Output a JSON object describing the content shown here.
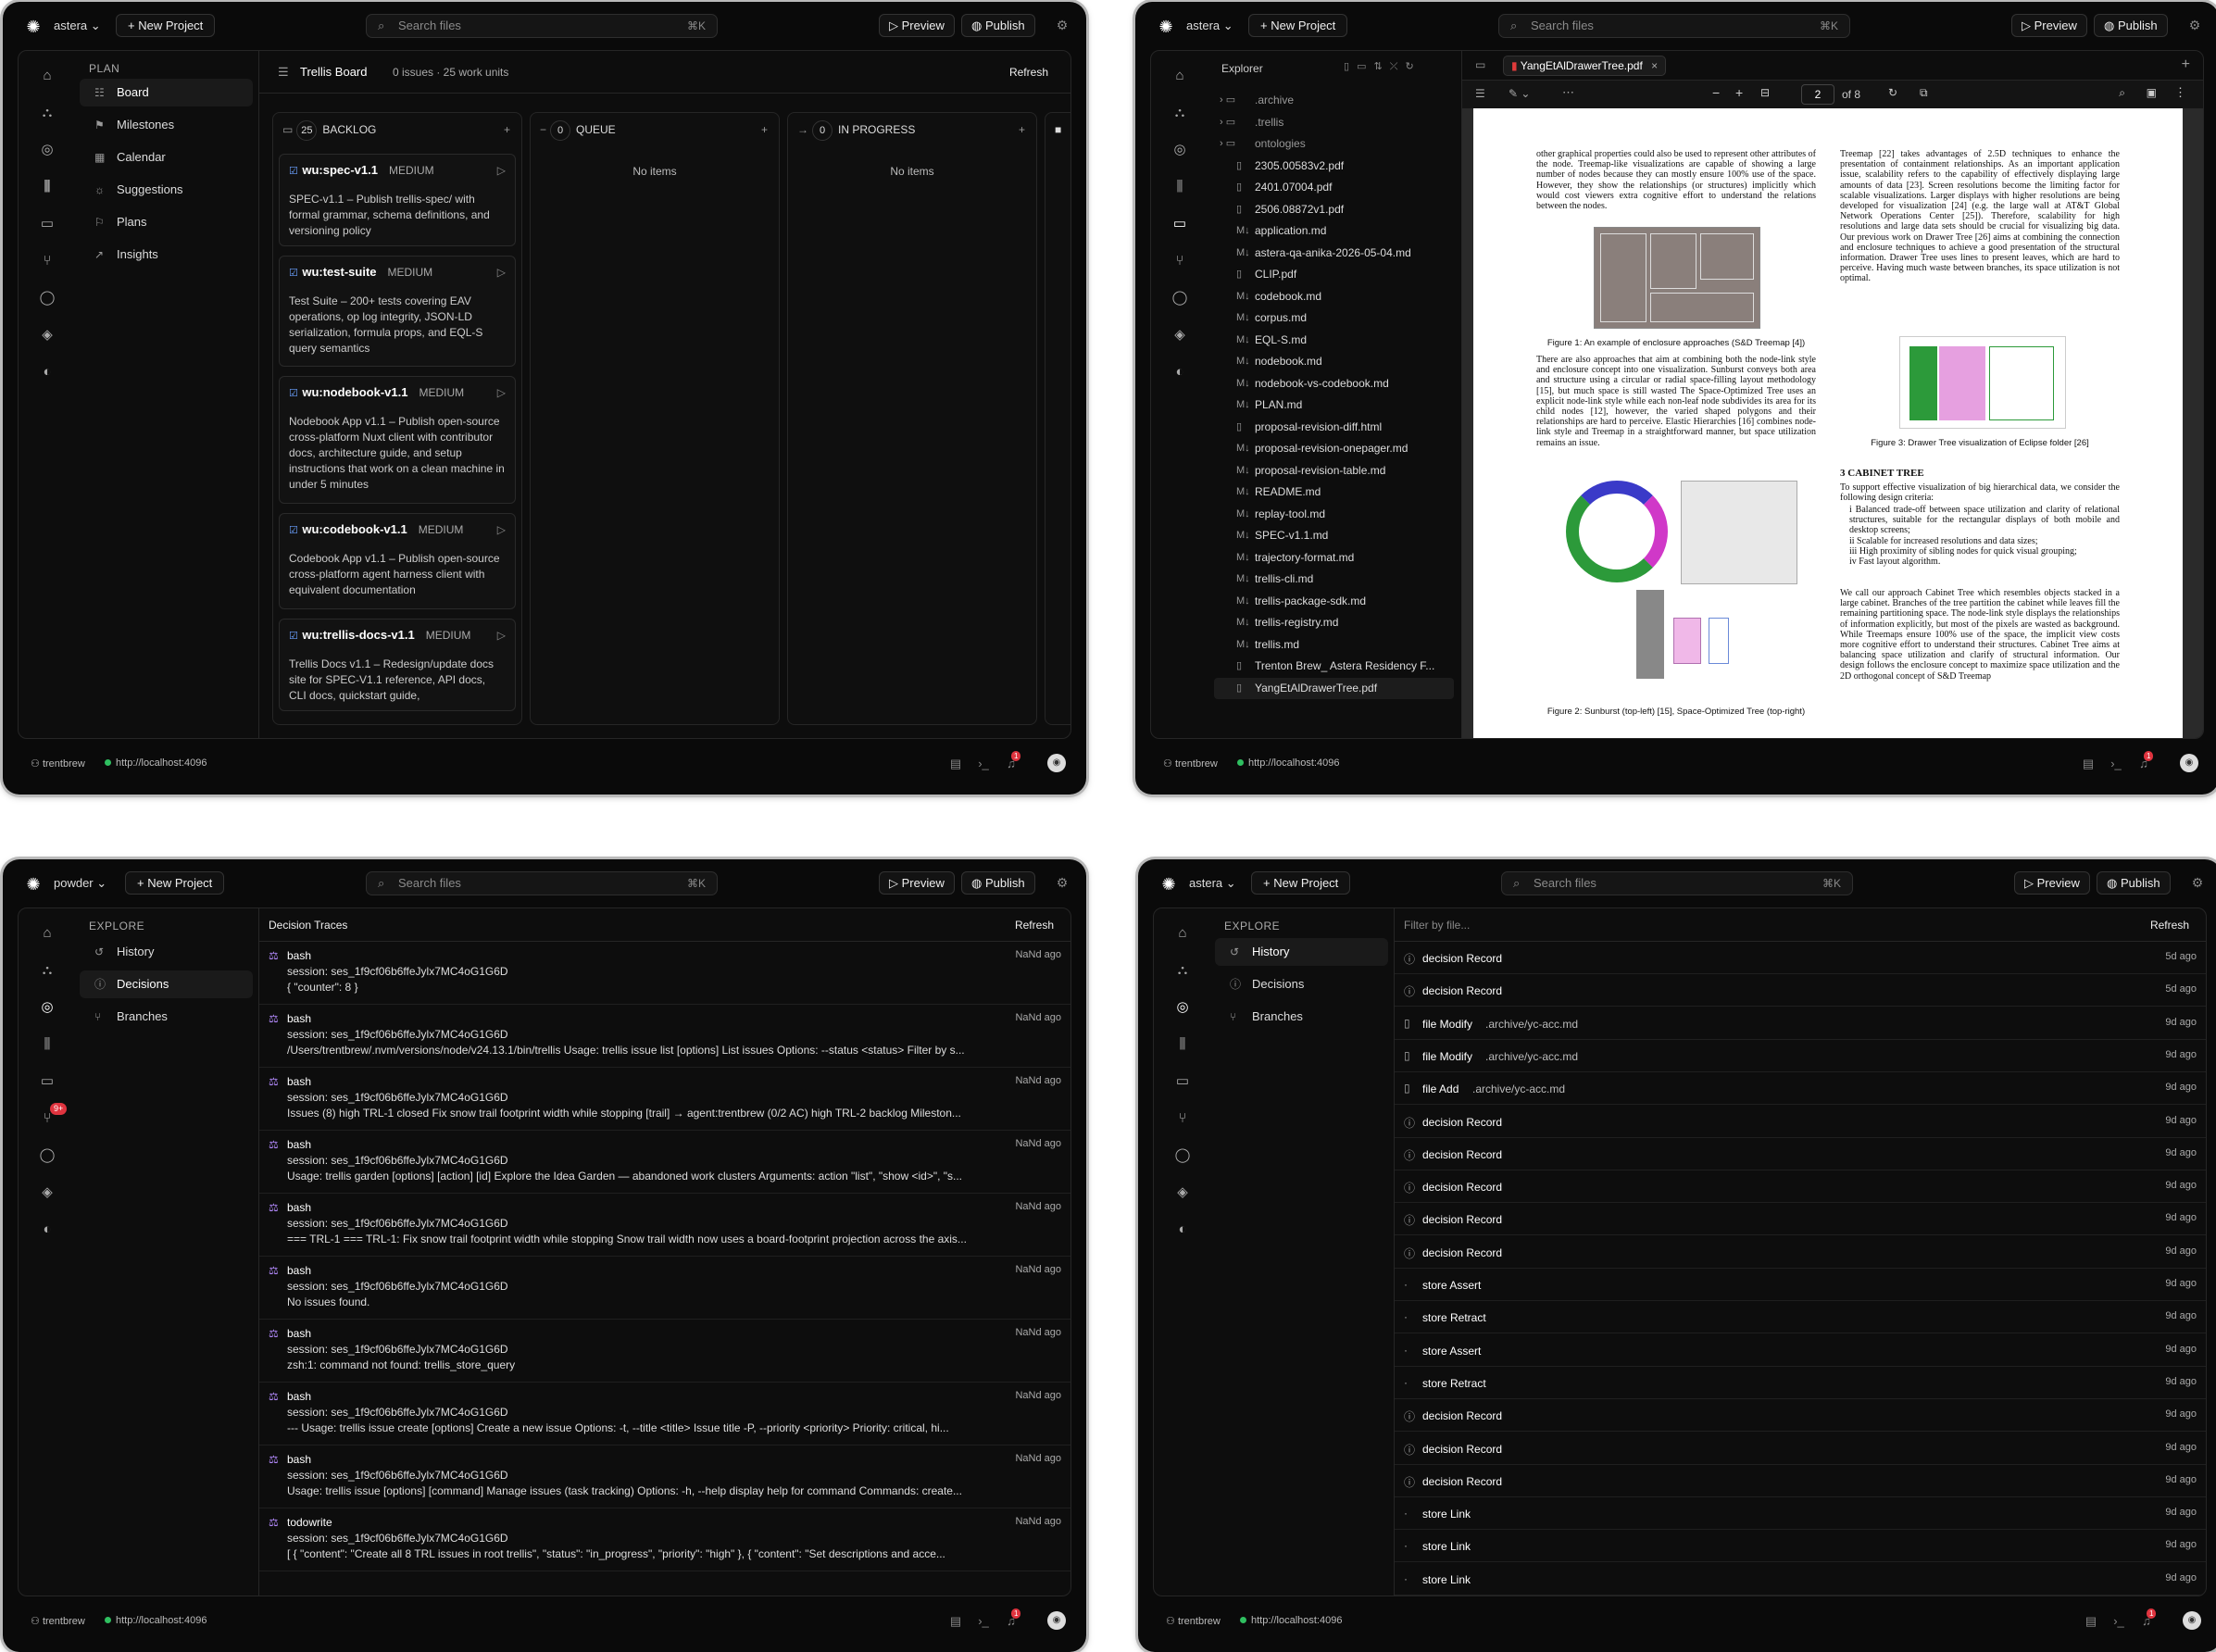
{
  "common": {
    "search_placeholder": "Search files",
    "search_kbd": "⌘K",
    "new_project": "New Project",
    "preview": "Preview",
    "publish": "Publish",
    "user": "trentbrew",
    "host": "http://localhost:4096",
    "notif_count": "1"
  },
  "w1": {
    "project": "astera",
    "sidebar_heading": "PLAN",
    "sidebar_items": [
      "Board",
      "Milestones",
      "Calendar",
      "Suggestions",
      "Plans",
      "Insights"
    ],
    "board_title": "Trellis Board",
    "board_meta": "0 issues · 25 work units",
    "refresh": "Refresh",
    "columns": [
      {
        "name": "BACKLOG",
        "count": "25"
      },
      {
        "name": "QUEUE",
        "count": "0",
        "empty": "No items"
      },
      {
        "name": "IN PROGRESS",
        "count": "0",
        "empty": "No items"
      }
    ],
    "cards": [
      {
        "title": "wu:spec-v1.1",
        "priority": "MEDIUM",
        "desc": "SPEC-v1.1 – Publish trellis-spec/ with formal grammar, schema definitions, and versioning policy"
      },
      {
        "title": "wu:test-suite",
        "priority": "MEDIUM",
        "desc": "Test Suite – 200+ tests covering EAV operations, op log integrity, JSON-LD serialization, formula props, and EQL-S query semantics"
      },
      {
        "title": "wu:nodebook-v1.1",
        "priority": "MEDIUM",
        "desc": "Nodebook App v1.1 – Publish open-source cross-platform Nuxt client with contributor docs, architecture guide, and setup instructions that work on a clean machine in under 5 minutes"
      },
      {
        "title": "wu:codebook-v1.1",
        "priority": "MEDIUM",
        "desc": "Codebook App v1.1 – Publish open-source cross-platform agent harness client with equivalent documentation"
      },
      {
        "title": "wu:trellis-docs-v1.1",
        "priority": "MEDIUM",
        "desc": "Trellis Docs v1.1 – Redesign/update docs site for SPEC-V1.1 reference, API docs, CLI docs, quickstart guide,"
      }
    ]
  },
  "w2": {
    "project": "astera",
    "explorer_title": "Explorer",
    "tab_name": "YangEtAlDrawerTree.pdf",
    "page_num": "2",
    "page_total": "of 8",
    "files": [
      ".archive",
      ".trellis",
      "ontologies",
      "2305.00583v2.pdf",
      "2401.07004.pdf",
      "2506.08872v1.pdf",
      "application.md",
      "astera-qa-anika-2026-05-04.md",
      "CLIP.pdf",
      "codebook.md",
      "corpus.md",
      "EQL-S.md",
      "nodebook.md",
      "nodebook-vs-codebook.md",
      "PLAN.md",
      "proposal-revision-diff.html",
      "proposal-revision-onepager.md",
      "proposal-revision-table.md",
      "README.md",
      "replay-tool.md",
      "SPEC-v1.1.md",
      "trajectory-format.md",
      "trellis-cli.md",
      "trellis-package-sdk.md",
      "trellis-registry.md",
      "trellis.md",
      "Trenton Brew_ Astera Residency F...",
      "YangEtAlDrawerTree.pdf"
    ],
    "pdf": {
      "left_col_1": "other graphical properties could also be used to represent other attributes of the node. Treemap-like visualizations are capable of showing a large number of nodes because they can mostly ensure 100% use of the space. However, they show the relationships (or structures) implicitly which would cost viewers extra cognitive effort to understand the relations between the nodes.",
      "fig1_caption": "Figure 1: An example of enclosure approaches (S&D Treemap [4])",
      "left_col_2": "There are also approaches that aim at combining both the node-link style and enclosure concept into one visualization. Sunburst conveys both area and structure using a circular or radial space-filling layout methodology [15], but much space is still wasted The Space-Optimized Tree uses an explicit node-link style while each non-leaf node subdivides its area for its child nodes [12], however, the varied shaped polygons and their relationships are hard to perceive. Elastic Hierarchies [16] combines node-link style and Treemap in a straightforward manner, but space utilization remains an issue.",
      "fig2_caption": "Figure 2: Sunburst (top-left) [15], Space-Optimized Tree (top-right)",
      "right_col_1": "Treemap [22] takes advantages of 2.5D techniques to enhance the presentation of containment relationships. As an important application issue, scalability refers to the capability of effectively displaying large amounts of data [23]. Screen resolutions become the limiting factor for scalable visualizations. Larger displays with higher resolutions are being developed for visualization [24] (e.g. the large wall at AT&T Global Network Operations Center [25]). Therefore, scalability for high resolutions and large data sets should be crucial for visualizing big data. Our previous work on Drawer Tree [26] aims at combining the connection and enclosure techniques to achieve a good presentation of the structural information. Drawer Tree uses lines to present leaves, which are hard to perceive. Having much waste between branches, its space utilization is not optimal.",
      "fig3_caption": "Figure 3: Drawer Tree visualization of Eclipse folder [26]",
      "section": "3 CABINET TREE",
      "right_col_2": "To support effective visualization of big hierarchical data, we consider the following design criteria:",
      "criteria": [
        "i Balanced trade-off between space utilization and clarity of relational structures, suitable for the rectangular displays of both mobile and desktop screens;",
        "ii Scalable for increased resolutions and data sizes;",
        "iii High proximity of sibling nodes for quick visual grouping;",
        "iv Fast layout algorithm."
      ],
      "right_col_3": "We call our approach Cabinet Tree which resembles objects stacked in a large cabinet. Branches of the tree partition the cabinet while leaves fill the remaining partitioning space. The node-link style displays the relationships of information explicitly, but most of the pixels are wasted as background. While Treemaps ensure 100% use of the space, the implicit view costs more cognitive effort to understand their structures. Cabinet Tree aims at balancing space utilization and clarify of structural information. Our design follows the enclosure concept to maximize space utilization and the 2D orthogonal concept of S&D Treemap"
    }
  },
  "w3": {
    "project": "powder",
    "rail_badge": "9+",
    "sidebar_heading": "EXPLORE",
    "sidebar_items": [
      "History",
      "Decisions",
      "Branches"
    ],
    "title": "Decision Traces",
    "refresh": "Refresh",
    "traces": [
      {
        "tool": "bash",
        "session": "session: ses_1f9cf06b6ffeJylx7MC4oG1G6D",
        "detail": "{ \"counter\": 8 }",
        "ago": "NaNd ago"
      },
      {
        "tool": "bash",
        "session": "session: ses_1f9cf06b6ffeJylx7MC4oG1G6D",
        "detail": "/Users/trentbrew/.nvm/versions/node/v24.13.1/bin/trellis Usage: trellis issue list [options] List issues Options: --status <status> Filter by s...",
        "ago": "NaNd ago"
      },
      {
        "tool": "bash",
        "session": "session: ses_1f9cf06b6ffeJylx7MC4oG1G6D",
        "detail": "Issues (8) high TRL-1 closed Fix snow trail footprint width while stopping [trail] → agent:trentbrew (0/2 AC) high TRL-2 backlog Mileston...",
        "ago": "NaNd ago"
      },
      {
        "tool": "bash",
        "session": "session: ses_1f9cf06b6ffeJylx7MC4oG1G6D",
        "detail": "Usage: trellis garden [options] [action] [id] Explore the Idea Garden — abandoned work clusters Arguments: action \"list\", \"show <id>\", \"s...",
        "ago": "NaNd ago"
      },
      {
        "tool": "bash",
        "session": "session: ses_1f9cf06b6ffeJylx7MC4oG1G6D",
        "detail": "=== TRL-1 === TRL-1: Fix snow trail footprint width while stopping Snow trail width now uses a board-footprint projection across the axis...",
        "ago": "NaNd ago"
      },
      {
        "tool": "bash",
        "session": "session: ses_1f9cf06b6ffeJylx7MC4oG1G6D",
        "detail": "No issues found.",
        "ago": "NaNd ago"
      },
      {
        "tool": "bash",
        "session": "session: ses_1f9cf06b6ffeJylx7MC4oG1G6D",
        "detail": "zsh:1: command not found: trellis_store_query",
        "ago": "NaNd ago"
      },
      {
        "tool": "bash",
        "session": "session: ses_1f9cf06b6ffeJylx7MC4oG1G6D",
        "detail": "--- Usage: trellis issue create [options] Create a new issue Options: -t, --title <title> Issue title -P, --priority <priority> Priority: critical, hi...",
        "ago": "NaNd ago"
      },
      {
        "tool": "bash",
        "session": "session: ses_1f9cf06b6ffeJylx7MC4oG1G6D",
        "detail": "Usage: trellis issue [options] [command] Manage issues (task tracking) Options: -h, --help display help for command Commands: create...",
        "ago": "NaNd ago"
      },
      {
        "tool": "todowrite",
        "session": "session: ses_1f9cf06b6ffeJylx7MC4oG1G6D",
        "detail": "[ { \"content\": \"Create all 8 TRL issues in root trellis\", \"status\": \"in_progress\", \"priority\": \"high\" }, { \"content\": \"Set descriptions and acce...",
        "ago": "NaNd ago"
      }
    ]
  },
  "w4": {
    "project": "astera",
    "sidebar_heading": "EXPLORE",
    "sidebar_items": [
      "History",
      "Decisions",
      "Branches"
    ],
    "filter_placeholder": "Filter by file...",
    "refresh": "Refresh",
    "history": [
      {
        "kind": "decision Record",
        "file": "",
        "ago": "5d ago",
        "icon": "info"
      },
      {
        "kind": "decision Record",
        "file": "",
        "ago": "5d ago",
        "icon": "info"
      },
      {
        "kind": "file Modify",
        "file": ".archive/yc-acc.md",
        "ago": "9d ago",
        "icon": "file"
      },
      {
        "kind": "file Modify",
        "file": ".archive/yc-acc.md",
        "ago": "9d ago",
        "icon": "file"
      },
      {
        "kind": "file Add",
        "file": ".archive/yc-acc.md",
        "ago": "9d ago",
        "icon": "file"
      },
      {
        "kind": "decision Record",
        "file": "",
        "ago": "9d ago",
        "icon": "info"
      },
      {
        "kind": "decision Record",
        "file": "",
        "ago": "9d ago",
        "icon": "info"
      },
      {
        "kind": "decision Record",
        "file": "",
        "ago": "9d ago",
        "icon": "info"
      },
      {
        "kind": "decision Record",
        "file": "",
        "ago": "9d ago",
        "icon": "info"
      },
      {
        "kind": "decision Record",
        "file": "",
        "ago": "9d ago",
        "icon": "info"
      },
      {
        "kind": "store Assert",
        "file": "",
        "ago": "9d ago",
        "icon": "dot"
      },
      {
        "kind": "store Retract",
        "file": "",
        "ago": "9d ago",
        "icon": "dot"
      },
      {
        "kind": "store Assert",
        "file": "",
        "ago": "9d ago",
        "icon": "dot"
      },
      {
        "kind": "store Retract",
        "file": "",
        "ago": "9d ago",
        "icon": "dot"
      },
      {
        "kind": "decision Record",
        "file": "",
        "ago": "9d ago",
        "icon": "info"
      },
      {
        "kind": "decision Record",
        "file": "",
        "ago": "9d ago",
        "icon": "info"
      },
      {
        "kind": "decision Record",
        "file": "",
        "ago": "9d ago",
        "icon": "info"
      },
      {
        "kind": "store Link",
        "file": "",
        "ago": "9d ago",
        "icon": "dot"
      },
      {
        "kind": "store Link",
        "file": "",
        "ago": "9d ago",
        "icon": "dot"
      },
      {
        "kind": "store Link",
        "file": "",
        "ago": "9d ago",
        "icon": "dot"
      }
    ]
  }
}
